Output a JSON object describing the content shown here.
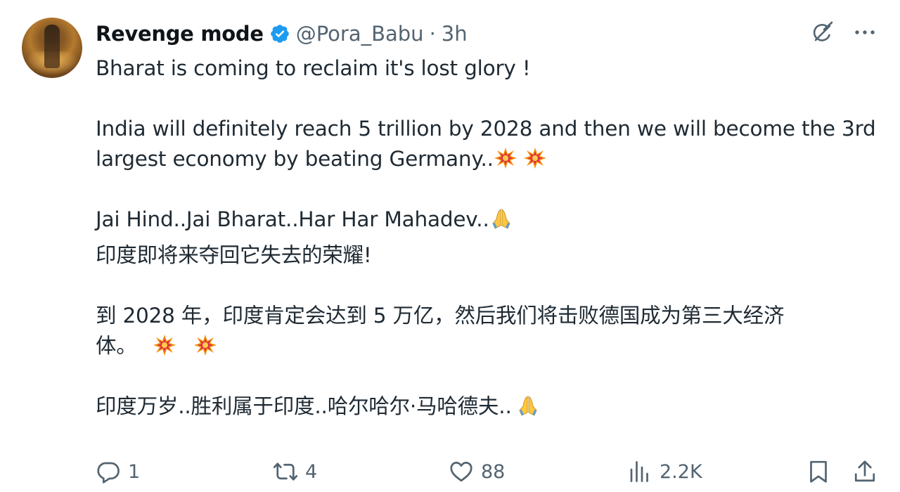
{
  "author": {
    "name": "Revenge mode",
    "handle": "@Pora_Babu",
    "separator": "·",
    "time": "3h"
  },
  "tweet": {
    "line1": "Bharat is coming to reclaim it's lost glory !",
    "line2a": "India will definitely reach 5 trillion by 2028 and then we will become the 3rd",
    "line2b": "largest economy by beating Germany..",
    "line3": "Jai Hind..Jai Bharat..Har Har Mahadev..",
    "zh1": "印度即将来夺回它失去的荣耀!",
    "zh2a": "到 2028 年，印度肯定会达到 5 万亿，然后我们将击败德国成为第三大经济",
    "zh2b": "体。",
    "zh3": "印度万岁..胜利属于印度..哈尔哈尔·马哈德夫.."
  },
  "icons": {
    "verified": "verified-badge-icon",
    "grok": "grok-icon",
    "more": "more-icon",
    "collision": "collision-emoji",
    "pray": "folded-hands-emoji"
  },
  "actions": {
    "replies": "1",
    "reposts": "4",
    "likes": "88",
    "views": "2.2K"
  },
  "colors": {
    "verified_blue": "#1d9bf0",
    "secondary_text": "#536471"
  }
}
